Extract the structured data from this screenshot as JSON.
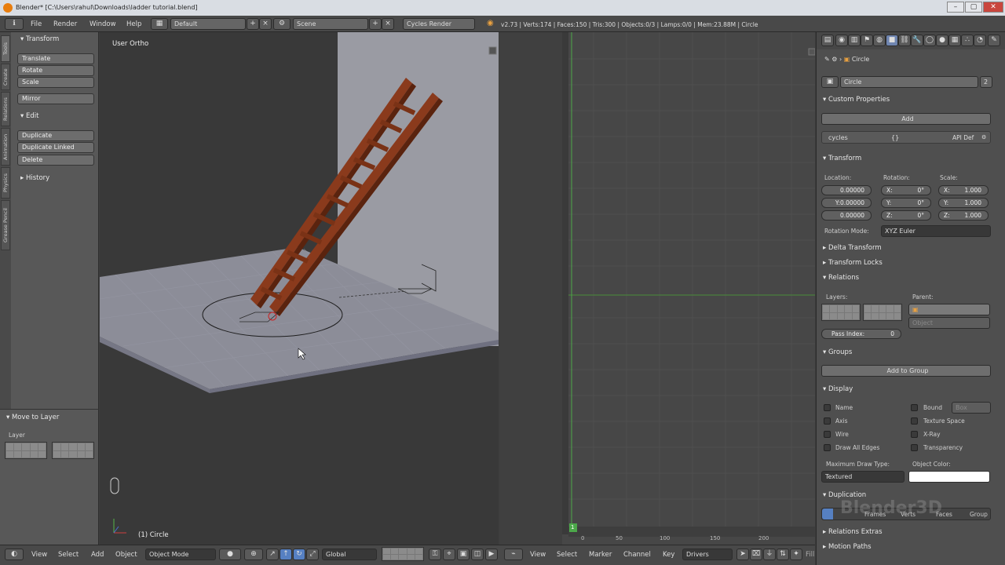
{
  "window": {
    "title": "Blender* [C:\\Users\\rahul\\Downloads\\ladder tutorial.blend]",
    "minimize": "–",
    "maximize": "▢",
    "close": "✕"
  },
  "topbar": {
    "menus": [
      "File",
      "Render",
      "Window",
      "Help"
    ],
    "layout": "Default",
    "scene": "Scene",
    "engine": "Cycles Render",
    "stats": "v2.73 | Verts:174 | Faces:150 | Tris:300 | Objects:0/3 | Lamps:0/0 | Mem:23.88M | Circle"
  },
  "toolshelf": {
    "tabs": [
      "Tools",
      "Create",
      "Relations",
      "Animation",
      "Physics",
      "Grease Pencil"
    ],
    "transform_header": "Transform",
    "transform_buttons": [
      "Translate",
      "Rotate",
      "Scale"
    ],
    "mirror": "Mirror",
    "edit_header": "Edit",
    "edit_buttons": [
      "Duplicate",
      "Duplicate Linked",
      "Delete"
    ],
    "history_header": "History",
    "operator_header": "Move to Layer",
    "layer_label": "Layer"
  },
  "viewport": {
    "view_label": "User Ortho",
    "object_label": "(1) Circle",
    "colors": {
      "ladder": "#8a3a1c",
      "plane": "#8c8d98",
      "background": "#393939"
    }
  },
  "graph": {
    "frame_ticks": [
      "0",
      "50",
      "100",
      "150",
      "200"
    ],
    "current_frame": "1"
  },
  "bottombar": {
    "view": "View",
    "select": "Select",
    "add": "Add",
    "object": "Object",
    "mode": "Object Mode",
    "orientation": "Global",
    "g_view": "View",
    "g_select": "Select",
    "g_marker": "Marker",
    "g_channel": "Channel",
    "g_key": "Key",
    "g_mode": "Drivers",
    "g_fill": "Fill"
  },
  "props": {
    "breadcrumb": "Circle",
    "object_name": "Circle",
    "users": "2",
    "custom_props": {
      "header": "Custom Properties",
      "add": "Add",
      "name": "cycles",
      "value": "{}",
      "api": "API Def"
    },
    "transform": {
      "header": "Transform",
      "location_label": "Location:",
      "rotation_label": "Rotation:",
      "scale_label": "Scale:",
      "location": [
        "0.00000",
        "Y:0.00000",
        "0.00000"
      ],
      "rotation": [
        "X:",
        "Y:",
        "Z:"
      ],
      "rotation_vals": [
        "0°",
        "0°",
        "0°"
      ],
      "scale": [
        "X:",
        "Y:",
        "Z:"
      ],
      "scale_vals": [
        "1.000",
        "1.000",
        "1.000"
      ],
      "rotation_mode_label": "Rotation Mode:",
      "rotation_mode": "XYZ Euler"
    },
    "delta_transform": "Delta Transform",
    "transform_locks": "Transform Locks",
    "relations": {
      "header": "Relations",
      "layers": "Layers:",
      "parent": "Parent:",
      "parent_type": "Object",
      "pass_index": "Pass Index:",
      "pass_value": "0"
    },
    "groups": {
      "header": "Groups",
      "add": "Add to Group"
    },
    "display": {
      "header": "Display",
      "checks": [
        "Name",
        "Axis",
        "Wire",
        "Draw All Edges"
      ],
      "checks2": [
        "Bound",
        "Texture Space",
        "X-Ray",
        "Transparency"
      ],
      "bound_type": "Box",
      "max_draw_label": "Maximum Draw Type:",
      "max_draw": "Textured",
      "color_label": "Object Color:",
      "object_color": "#ffffff"
    },
    "duplication": {
      "header": "Duplication",
      "options": [
        "Frames",
        "Verts",
        "Faces",
        "Group"
      ],
      "watermark": "Blender3D"
    },
    "relations_extras": "Relations Extras",
    "motion_paths": "Motion Paths"
  }
}
